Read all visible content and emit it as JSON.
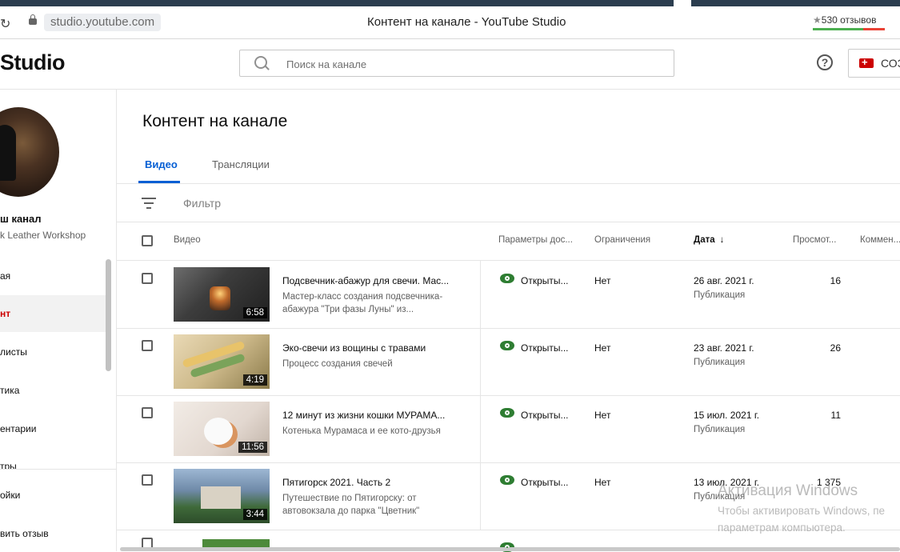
{
  "browser": {
    "reload_glyph": "↻",
    "url": "studio.youtube.com",
    "page_title": "Контент на канале - YouTube Studio",
    "reviews": "530 отзывов"
  },
  "header": {
    "logo": "Studio",
    "search_placeholder": "Поиск на канале",
    "help_glyph": "?",
    "create_label": "СОЗ"
  },
  "sidebar": {
    "channel_label": "ш канал",
    "channel_name": "k Leather Workshop",
    "items": [
      {
        "label": "ая"
      },
      {
        "label": "нт"
      },
      {
        "label": "листы"
      },
      {
        "label": "тика"
      },
      {
        "label": "ентарии"
      },
      {
        "label": "тры"
      }
    ],
    "bottom_items": [
      {
        "label": "ойки"
      },
      {
        "label": "вить отзыв"
      }
    ]
  },
  "main": {
    "title": "Контент на канале",
    "tabs": [
      {
        "label": "Видео",
        "active": true
      },
      {
        "label": "Трансляции",
        "active": false
      }
    ],
    "filter_label": "Фильтр",
    "columns": {
      "video": "Видео",
      "visibility": "Параметры дос...",
      "restrictions": "Ограничения",
      "date": "Дата",
      "views": "Просмот...",
      "comments": "Коммен..."
    },
    "rows": [
      {
        "title": "Подсвечник-абажур для свечи. Мас...",
        "desc": "Мастер-класс создания подсвечника-абажура \"Три фазы Луны\" из...",
        "duration": "6:58",
        "visibility": "Открыты...",
        "restrictions": "Нет",
        "date": "26 авг. 2021 г.",
        "date_type": "Публикация",
        "views": "16"
      },
      {
        "title": "Эко-свечи из вощины с травами",
        "desc": "Процесс создания свечей",
        "duration": "4:19",
        "visibility": "Открыты...",
        "restrictions": "Нет",
        "date": "23 авг. 2021 г.",
        "date_type": "Публикация",
        "views": "26"
      },
      {
        "title": "12 минут из жизни кошки МУРАМА...",
        "desc": "Котенька Мурамаса и ее кото-друзья",
        "duration": "11:56",
        "visibility": "Открыты...",
        "restrictions": "Нет",
        "date": "15 июл. 2021 г.",
        "date_type": "Публикация",
        "views": "11"
      },
      {
        "title": "Пятигорск 2021. Часть 2",
        "desc": "Путешествие по Пятигорску: от автовокзала до парка \"Цветник\"",
        "duration": "3:44",
        "visibility": "Открыты...",
        "restrictions": "Нет",
        "date": "13 июл. 2021 г.",
        "date_type": "Публикация",
        "views": "1 375"
      }
    ]
  },
  "watermark": {
    "line1": "Активация Windows",
    "line2": "Чтобы активировать Windows, пе",
    "line3": "параметрам компьютера."
  },
  "colors": {
    "accent_blue": "#065fd4",
    "brand_red": "#cc0000",
    "public_green": "#2e7d32"
  }
}
